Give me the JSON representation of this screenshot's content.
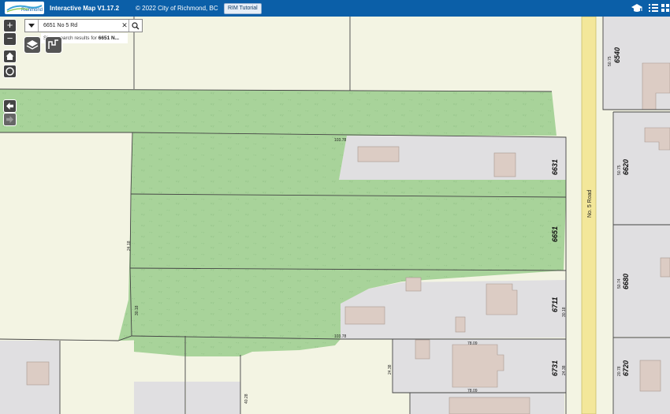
{
  "header": {
    "logo_text": "Richmond",
    "title": "Interactive Map V1.17.2",
    "copyright": "© 2022 City of Richmond, BC",
    "tutorial_button": "RIM Tutorial"
  },
  "search": {
    "value": "6651 No 5 Rd",
    "hint_prefix": "Show search results for ",
    "hint_term": "6651 N..."
  },
  "map": {
    "street_name": "No. 5 Road",
    "address_numbers": {
      "a6540": "6540",
      "a6620": "6620",
      "a6631": "6631",
      "a6651": "6651",
      "a6680": "6680",
      "a6711": "6711",
      "a6720": "6720",
      "a6731": "6731"
    },
    "dimensions": {
      "d1": "103.78",
      "d2": "103.78",
      "d3": "24.18",
      "d4": "30.18",
      "d5": "40.28",
      "d6": "24.38",
      "d7": "78.09",
      "d8": "78.09",
      "d9": "30.18",
      "d10": "24.38",
      "d11": "50.75",
      "d12": "50.75",
      "d13": "50.74",
      "d14": "20.78"
    },
    "colors": {
      "base": "#f3f4e3",
      "green": "#a8d39a",
      "parcel_grey": "#e0dfe1",
      "building": "#dcccc4",
      "road_yellow": "#f3e79a"
    }
  }
}
